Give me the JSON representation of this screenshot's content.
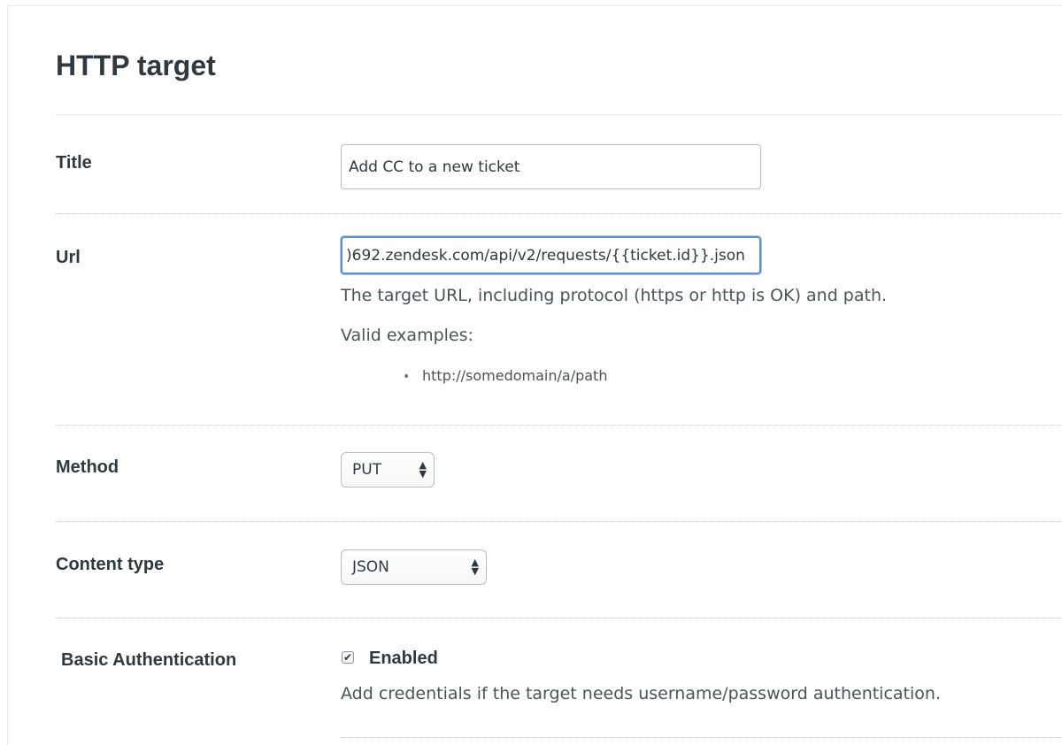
{
  "header": {
    "title": "HTTP target"
  },
  "fields": {
    "title": {
      "label": "Title",
      "value": "Add CC to a new ticket"
    },
    "url": {
      "label": "Url",
      "value": ")692.zendesk.com/api/v2/requests/{{ticket.id}}.json",
      "hint": "The target URL, including protocol (https or http is OK) and path.",
      "examples_heading": "Valid examples:",
      "examples": [
        "http://somedomain/a/path"
      ],
      "focused": true
    },
    "method": {
      "label": "Method",
      "selected": "PUT"
    },
    "content_type": {
      "label": "Content type",
      "selected": "JSON"
    },
    "basic_auth": {
      "label": "Basic Authentication",
      "checkbox_label": "Enabled",
      "checked": true,
      "hint": "Add credentials if the target needs username/password authentication."
    }
  },
  "icons": {
    "bullet": "bullet-dot-icon",
    "select_arrows": "up-down-chevron-icon",
    "checkmark": "checkmark-icon"
  },
  "colors": {
    "text": "#2f3941",
    "muted_text": "#49545c",
    "focus_ring": "#5b8fd6",
    "border": "#b9bec2"
  }
}
